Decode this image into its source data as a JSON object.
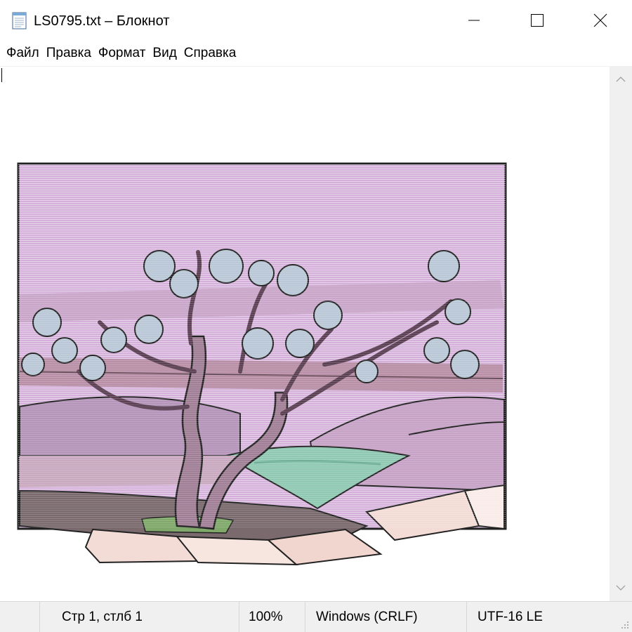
{
  "window": {
    "title": "LS0795.txt – Блокнот"
  },
  "menu": {
    "items": [
      {
        "label": "Файл"
      },
      {
        "label": "Правка"
      },
      {
        "label": "Формат"
      },
      {
        "label": "Вид"
      },
      {
        "label": "Справка"
      }
    ]
  },
  "status": {
    "position": "Стр 1, стлб 1",
    "zoom": "100%",
    "line_endings": "Windows (CRLF)",
    "encoding": "UTF-16 LE"
  },
  "icons": {
    "app": "notepad-icon",
    "minimize": "minimize-icon",
    "maximize": "maximize-icon",
    "close": "close-icon",
    "scroll_up": "chevron-up-icon",
    "scroll_down": "chevron-down-icon",
    "grip": "resize-grip-icon"
  },
  "colors": {
    "sky": "#d4afd9",
    "water": "#8fc9b4",
    "trunk": "#a07e96",
    "rock": "#f3dcd6",
    "ground": "#7a6a6e",
    "grass": "#7fa86a"
  }
}
